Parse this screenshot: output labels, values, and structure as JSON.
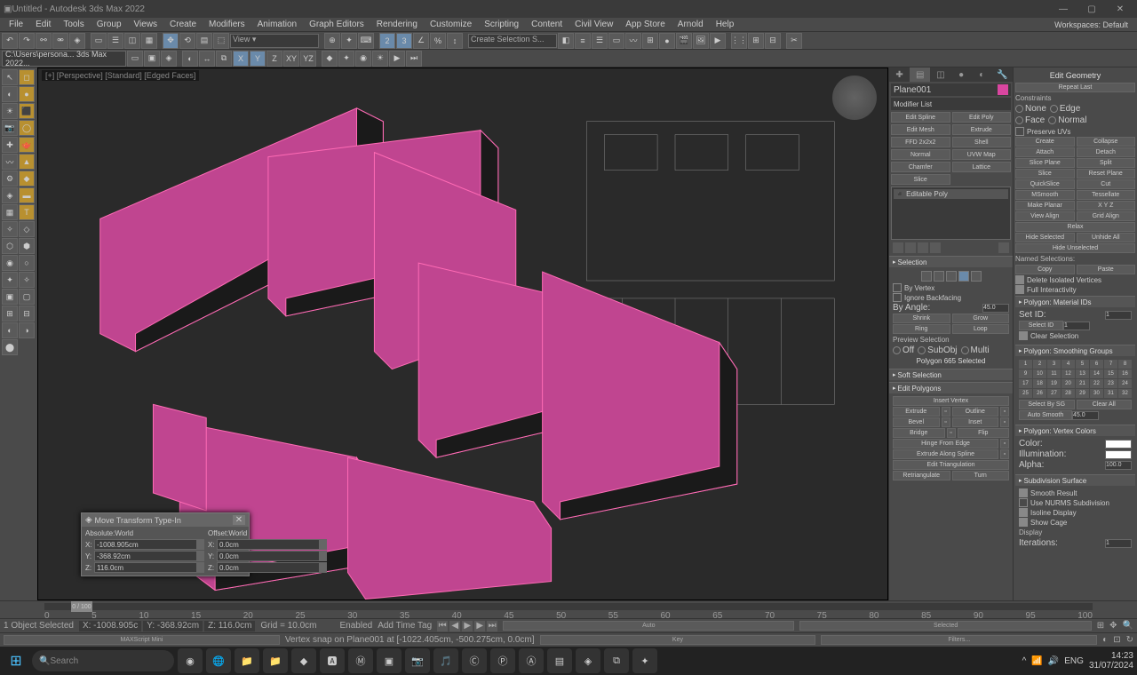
{
  "title": "Untitled - Autodesk 3ds Max 2022",
  "menu": [
    "File",
    "Edit",
    "Tools",
    "Group",
    "Views",
    "Create",
    "Modifiers",
    "Animation",
    "Graph Editors",
    "Rendering",
    "Customize",
    "Scripting",
    "Content",
    "Civil View",
    "App Store",
    "Arnold",
    "Help"
  ],
  "workspace": "Workspaces: Default",
  "filepath": "C:\\Users\\persona... 3ds Max 2022...",
  "selection_set_placeholder": "Create Selection S...",
  "viewport": {
    "label": "[+] [Perspective] [Standard] [Edged Faces]"
  },
  "move_dialog": {
    "title": "Move Transform Type-In",
    "abs_label": "Absolute:World",
    "off_label": "Offset:World",
    "abs": {
      "x": "-1008.905cm",
      "y": "-368.92cm",
      "z": "116.0cm"
    },
    "off": {
      "x": "0.0cm",
      "y": "0.0cm",
      "z": "0.0cm"
    }
  },
  "cmd": {
    "object_name": "Plane001",
    "modifier_list": "Modifier List",
    "mod_buttons": [
      "Edit Spline",
      "Edit Poly",
      "Edit Mesh",
      "Extrude",
      "FFD 2x2x2",
      "Shell",
      "Normal",
      "UVW Map",
      "Chamfer",
      "Lattice",
      "Slice"
    ],
    "stack_item": "◾ Editable Poly",
    "selection_hdr": "Selection",
    "by_vertex": "By Vertex",
    "ignore_backfacing": "Ignore Backfacing",
    "by_angle": "By Angle:",
    "by_angle_val": "45.0",
    "shrink": "Shrink",
    "grow": "Grow",
    "ring": "Ring",
    "loop": "Loop",
    "preview_sel": "Preview Selection",
    "off": "Off",
    "subobj": "SubObj",
    "multi": "Multi",
    "poly_selected": "Polygon 665 Selected",
    "soft_sel": "Soft Selection",
    "edit_poly_hdr": "Edit Polygons",
    "insert_vertex": "Insert Vertex",
    "extrude": "Extrude",
    "outline": "Outline",
    "bevel": "Bevel",
    "inset": "Inset",
    "bridge": "Bridge",
    "flip": "Flip",
    "hinge": "Hinge From Edge",
    "extrude_spline": "Extrude Along Spline",
    "edit_tri": "Edit Triangulation",
    "retri": "Retriangulate",
    "turn": "Turn"
  },
  "geom": {
    "header": "Edit Geometry",
    "repeat_last": "Repeat Last",
    "constraints": "Constraints",
    "none": "None",
    "edge": "Edge",
    "face": "Face",
    "normal": "Normal",
    "preserve_uv": "Preserve UVs",
    "create": "Create",
    "collapse": "Collapse",
    "attach": "Attach",
    "detach": "Detach",
    "slice_plane": "Slice Plane",
    "split": "Split",
    "slice": "Slice",
    "reset_plane": "Reset Plane",
    "quickslice": "QuickSlice",
    "cut": "Cut",
    "msmooth": "MSmooth",
    "tessellate": "Tessellate",
    "make_planar": "Make Planar",
    "xyz": "X  Y  Z",
    "view_align": "View Align",
    "grid_align": "Grid Align",
    "relax": "Relax",
    "hide_sel": "Hide Selected",
    "unhide_all": "Unhide All",
    "hide_unsel": "Hide Unselected",
    "named_sel": "Named Selections:",
    "copy": "Copy",
    "paste": "Paste",
    "del_iso": "Delete Isolated Vertices",
    "full_int": "Full Interactivity",
    "mat_ids": "Polygon: Material IDs",
    "set_id": "Set ID:",
    "select_id": "Select ID",
    "id_val": "1",
    "clear_sel": "Clear Selection",
    "smoothing": "Polygon: Smoothing Groups",
    "select_sg": "Select By SG",
    "clear_all": "Clear All",
    "auto_smooth": "Auto Smooth",
    "as_val": "45.0",
    "vertex_colors": "Polygon: Vertex Colors",
    "color": "Color:",
    "illum": "Illumination:",
    "alpha": "Alpha:",
    "alpha_val": "100.0",
    "subdiv": "Subdivision Surface",
    "smooth_result": "Smooth Result",
    "use_nurms": "Use NURMS Subdivision",
    "iso_display": "Isoline Display",
    "show_cage": "Show Cage",
    "display": "Display",
    "iterations": "Iterations:",
    "iter_val": "1"
  },
  "time": {
    "frame_label": "0 / 100",
    "ticks": [
      0,
      5,
      10,
      15,
      20,
      25,
      30,
      35,
      40,
      45,
      50,
      55,
      60,
      65,
      70,
      75,
      80,
      85,
      90,
      95,
      100
    ]
  },
  "status": {
    "selected": "1 Object Selected",
    "x": "X: -1008.905c",
    "y": "Y: -368.92cm",
    "z": "Z: 116.0cm",
    "grid": "Grid = 10.0cm",
    "enabled": "Enabled",
    "add_tag": "Add Time Tag",
    "auto": "Auto",
    "key": "Key",
    "selected2": "Selected",
    "filters": "Filters..."
  },
  "status2": {
    "maxscript": "MAXScript Mini",
    "snap": "Vertex snap on Plane001 at [-1022.405cm, -500.275cm, 0.0cm]"
  },
  "taskbar": {
    "search": "Search",
    "time": "14:23",
    "date": "31/07/2024"
  }
}
